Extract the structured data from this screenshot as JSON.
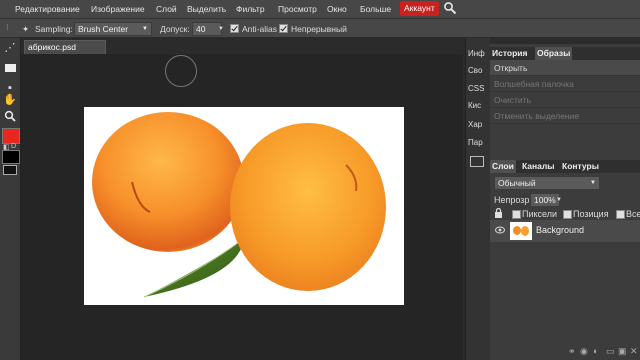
{
  "menubar": {
    "items": [
      "Редактирование",
      "Изображение",
      "Слой",
      "Выделить",
      "Фильтр",
      "Просмотр",
      "Окно",
      "Больше"
    ],
    "account": "Аккаунт",
    "search_icon": "search-icon"
  },
  "options": {
    "sampling_label": "Sampling:",
    "sampling_value": "Brush Center",
    "tolerance_label": "Допуск:",
    "tolerance_value": "40",
    "antialias_label": "Anti-alias",
    "antialias_checked": true,
    "contiguous_label": "Непрерывный",
    "contiguous_checked": true
  },
  "document": {
    "tab_title": "абрикос.psd"
  },
  "colors": {
    "foreground": "#e8251f",
    "background": "#000000",
    "accent": "#c8211f"
  },
  "side_strip": [
    "Инф",
    "Сво",
    "CSS",
    "Кис",
    "Хар",
    "Пар"
  ],
  "history_panel": {
    "tabs": [
      "История",
      "Образы"
    ],
    "items": [
      "Открыть",
      "Волшебная палочка",
      "Очистить",
      "Отменить выделение"
    ]
  },
  "layers_panel": {
    "tabs": [
      "Слои",
      "Каналы",
      "Контуры"
    ],
    "blend_mode": "Обычный",
    "opacity_label": "Непрозр.:",
    "opacity_value": "100%",
    "lock_options": [
      "Пиксели",
      "Позиция",
      "Все"
    ],
    "layers": [
      {
        "name": "Background",
        "visible": true
      }
    ]
  }
}
